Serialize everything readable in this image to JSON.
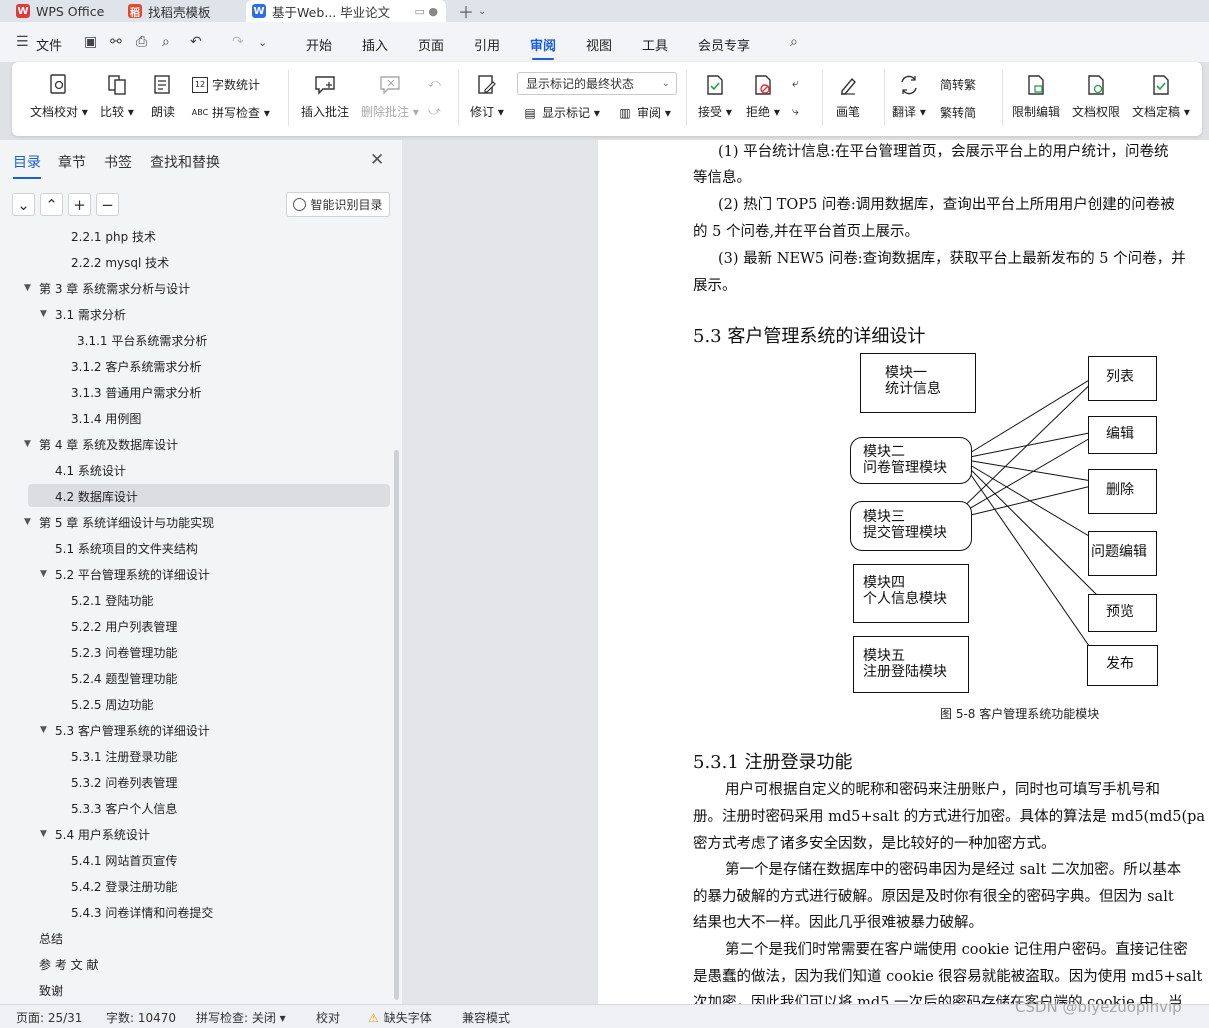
{
  "tabs": [
    {
      "label": "WPS Office"
    },
    {
      "label": "找稻壳模板"
    },
    {
      "label": "基于Web... 毕业论文"
    }
  ],
  "menu": {
    "file": "文件",
    "items": [
      "开始",
      "插入",
      "页面",
      "引用",
      "审阅",
      "视图",
      "工具",
      "会员专享"
    ],
    "active": "审阅"
  },
  "ribbon": {
    "proofread": "文档校对",
    "compare": "比较",
    "read_aloud": "朗读",
    "word_count": "字数统计",
    "spell_check": "拼写检查",
    "insert_comment": "插入批注",
    "delete_comment": "删除批注",
    "revise": "修订",
    "markup_select": "显示标记的最终状态",
    "show_markup": "显示标记",
    "review": "审阅",
    "accept": "接受",
    "reject": "拒绝",
    "ink": "画笔",
    "translate": "翻译",
    "to_traditional": "简转繁",
    "to_simplified": "繁转简",
    "restrict_edit": "限制编辑",
    "doc_permission": "文档权限",
    "doc_finalize": "文档定稿"
  },
  "left_pane": {
    "tabs": [
      "目录",
      "章节",
      "书签",
      "查找和替换"
    ],
    "smart_button": "智能识别目录",
    "toc": [
      {
        "label": "2.2.1  php 技术",
        "level": 3
      },
      {
        "label": "2.2.2  mysql 技术",
        "level": 3
      },
      {
        "label": "第 3 章  系统需求分析与设计",
        "level": 1,
        "expanded": true
      },
      {
        "label": "3.1  需求分析",
        "level": 2,
        "expanded": true
      },
      {
        "label": "3.1.1  平台系统需求分析",
        "level": 4
      },
      {
        "label": "3.1.2  客户系统需求分析",
        "level": 3
      },
      {
        "label": "3.1.3  普通用户需求分析",
        "level": 3
      },
      {
        "label": "3.1.4  用例图",
        "level": 3
      },
      {
        "label": "第 4 章  系统及数据库设计",
        "level": 1,
        "expanded": true
      },
      {
        "label": "4.1  系统设计",
        "level": 2
      },
      {
        "label": "4.2 数据库设计",
        "level": 2,
        "selected": true
      },
      {
        "label": "第 5 章  系统详细设计与功能实现",
        "level": 1,
        "expanded": true
      },
      {
        "label": "5.1    系统项目的文件夹结构",
        "level": 2
      },
      {
        "label": "5.2 平台管理系统的详细设计",
        "level": 2,
        "expanded": true
      },
      {
        "label": "5.2.1 登陆功能",
        "level": 3
      },
      {
        "label": "5.2.2  用户列表管理",
        "level": 3
      },
      {
        "label": "5.2.3  问卷管理功能",
        "level": 3
      },
      {
        "label": "5.2.4  题型管理功能",
        "level": 3
      },
      {
        "label": "5.2.5  周边功能",
        "level": 3
      },
      {
        "label": "5.3  客户管理系统的详细设计",
        "level": 2,
        "expanded": true
      },
      {
        "label": "5.3.1  注册登录功能",
        "level": 3
      },
      {
        "label": "5.3.2  问卷列表管理",
        "level": 3
      },
      {
        "label": "5.3.3  客户个人信息",
        "level": 3
      },
      {
        "label": "5.4  用户系统设计",
        "level": 2,
        "expanded": true
      },
      {
        "label": "5.4.1  网站首页宣传",
        "level": 3
      },
      {
        "label": "5.4.2  登录注册功能",
        "level": 3
      },
      {
        "label": "5.4.3  问卷详情和问卷提交",
        "level": 3
      },
      {
        "label": "总结",
        "level": 1
      },
      {
        "label": "参 考 文 献",
        "level": 1
      },
      {
        "label": "致谢",
        "level": 1
      }
    ]
  },
  "document": {
    "para1_l1": "(1) 平台统计信息:在平台管理首页，会展示平台上的用户统计，问卷统",
    "para1_l2": "等信息。",
    "para2_l1": "(2) 热门 TOP5 问卷:调用数据库，查询出平台上所用用户创建的问卷被",
    "para2_l2": "的 5 个问卷,并在平台首页上展示。",
    "para3_l1": "(3) 最新 NEW5 问卷:查询数据库，获取平台上最新发布的 5 个问卷，并",
    "para3_l2": "展示。",
    "heading_53": "5.3  客户管理系统的详细设计",
    "diagram": {
      "modules": [
        {
          "line1": "模块一",
          "line2": "统计信息"
        },
        {
          "line1": "模块二",
          "line2": "问卷管理模块"
        },
        {
          "line1": "模块三",
          "line2": "提交管理模块"
        },
        {
          "line1": "模块四",
          "line2": "个人信息模块"
        },
        {
          "line1": "模块五",
          "line2": "注册登陆模块"
        }
      ],
      "functions": [
        "列表",
        "编辑",
        "删除",
        "问题编辑",
        "预览",
        "发布"
      ]
    },
    "caption": "图 5-8  客户管理系统功能模块",
    "heading_531": "5.3.1  注册登录功能",
    "body": [
      "用户可根据自定义的昵称和密码来注册账户，同时也可填写手机号和",
      "册。注册时密码采用 md5+salt 的方式进行加密。具体的算法是  md5(md5(pa",
      "密方式考虑了诸多安全因数，是比较好的一种加密方式。",
      "第一个是存储在数据库中的密码串因为是经过 salt 二次加密。所以基本",
      "的暴力破解的方式进行破解。原因是及时你有很全的密码字典。但因为 salt",
      "结果也大不一样。因此几乎很难被暴力破解。",
      "第二个是我们时常需要在客户端使用 cookie 记住用户密码。直接记住密",
      "是愚蠢的做法，因为我们知道 cookie 很容易就能被盗取。因为使用 md5+salt",
      "次加密，因此我们可以将 md5 一次后的密码存储在客户端的 cookie 中，当"
    ]
  },
  "status": {
    "page": "页面: 25/31",
    "words": "字数: 10470",
    "spell": "拼写检查: 关闭",
    "proof": "校对",
    "missing_font": "缺失字体",
    "compat": "兼容模式"
  },
  "watermark": "CSDN @biyezuopinvip",
  "colors": {
    "accent": "#1a5ed8",
    "wps_red": "#e03a3a"
  }
}
